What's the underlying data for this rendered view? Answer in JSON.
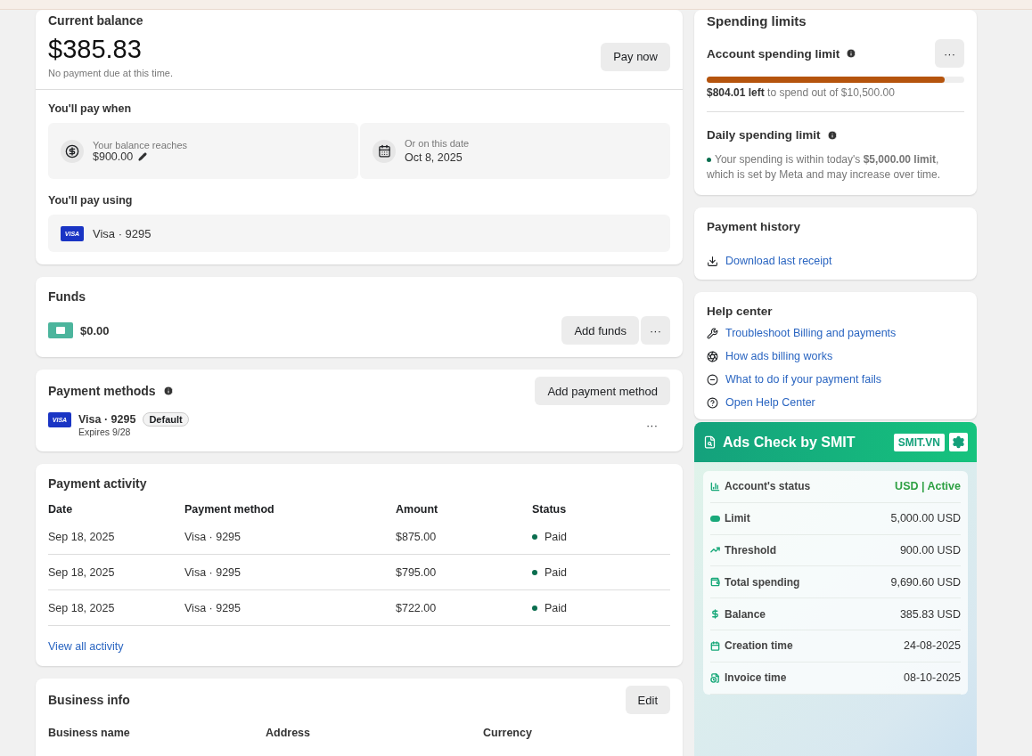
{
  "current_balance": {
    "title": "Current balance",
    "amount": "$385.83",
    "note": "No payment due at this time.",
    "pay_button": "Pay now",
    "pay_when": {
      "title": "You'll pay when",
      "threshold": {
        "label": "Your balance reaches",
        "value": "$900.00"
      },
      "date": {
        "label": "Or on this date",
        "value": "Oct 8, 2025"
      }
    },
    "pay_using": {
      "title": "You'll pay using",
      "card_brand": "VISA",
      "card": "Visa · 9295"
    }
  },
  "funds": {
    "title": "Funds",
    "amount": "$0.00",
    "add_button": "Add funds",
    "more": "···"
  },
  "payment_methods": {
    "title": "Payment methods",
    "add_button": "Add payment method",
    "card_brand": "VISA",
    "card": "Visa · 9295",
    "badge": "Default",
    "expires": "Expires 9/28",
    "more": "···"
  },
  "payment_activity": {
    "title": "Payment activity",
    "columns": [
      "Date",
      "Payment method",
      "Amount",
      "Status"
    ],
    "rows": [
      {
        "date": "Sep 18, 2025",
        "method": "Visa · 9295",
        "amount": "$875.00",
        "status": "Paid",
        "color": "#0b6e4f"
      },
      {
        "date": "Sep 18, 2025",
        "method": "Visa · 9295",
        "amount": "$795.00",
        "status": "Paid",
        "color": "#0b6e4f"
      },
      {
        "date": "Sep 18, 2025",
        "method": "Visa · 9295",
        "amount": "$722.00",
        "status": "Paid",
        "color": "#0b6e4f"
      }
    ],
    "view_all": "View all activity"
  },
  "business_info": {
    "title": "Business info",
    "edit_button": "Edit",
    "columns": [
      "Business name",
      "Address",
      "Currency"
    ]
  },
  "spending_limits": {
    "title": "Spending limits",
    "account_limit": {
      "title": "Account spending limit",
      "more": "···",
      "level": 0.925,
      "left": "$804.01 left",
      "rest": " to spend out of $10,500.00"
    },
    "daily_limit": {
      "title": "Daily spending limit",
      "text": "Your spending is within today's **$5,000.00 limit**, which is set by Meta and may increase over time."
    }
  },
  "payment_history": {
    "title": "Payment history",
    "link": "Download last receipt"
  },
  "help_center": {
    "title": "Help center",
    "links": [
      {
        "label": "Troubleshoot Billing and payments"
      },
      {
        "label": "How ads billing works"
      },
      {
        "label": "What to do if your payment fails"
      },
      {
        "label": "Open Help Center"
      }
    ]
  },
  "ads_check": {
    "title": "Ads Check by SMIT",
    "badge": "SMIT.VN",
    "rows": [
      {
        "label": "Account's status",
        "value": "USD | Active",
        "emphasis": true
      },
      {
        "label": "Limit",
        "value": "5,000.00 USD",
        "emphasis": false
      },
      {
        "label": "Threshold",
        "value": "900.00 USD",
        "emphasis": false
      },
      {
        "label": "Total spending",
        "value": "9,690.60 USD",
        "emphasis": false
      },
      {
        "label": "Balance",
        "value": "385.83 USD",
        "emphasis": false
      },
      {
        "label": "Creation time",
        "value": "24-08-2025",
        "emphasis": false
      },
      {
        "label": "Invoice time",
        "value": "08-10-2025",
        "emphasis": false
      }
    ]
  }
}
